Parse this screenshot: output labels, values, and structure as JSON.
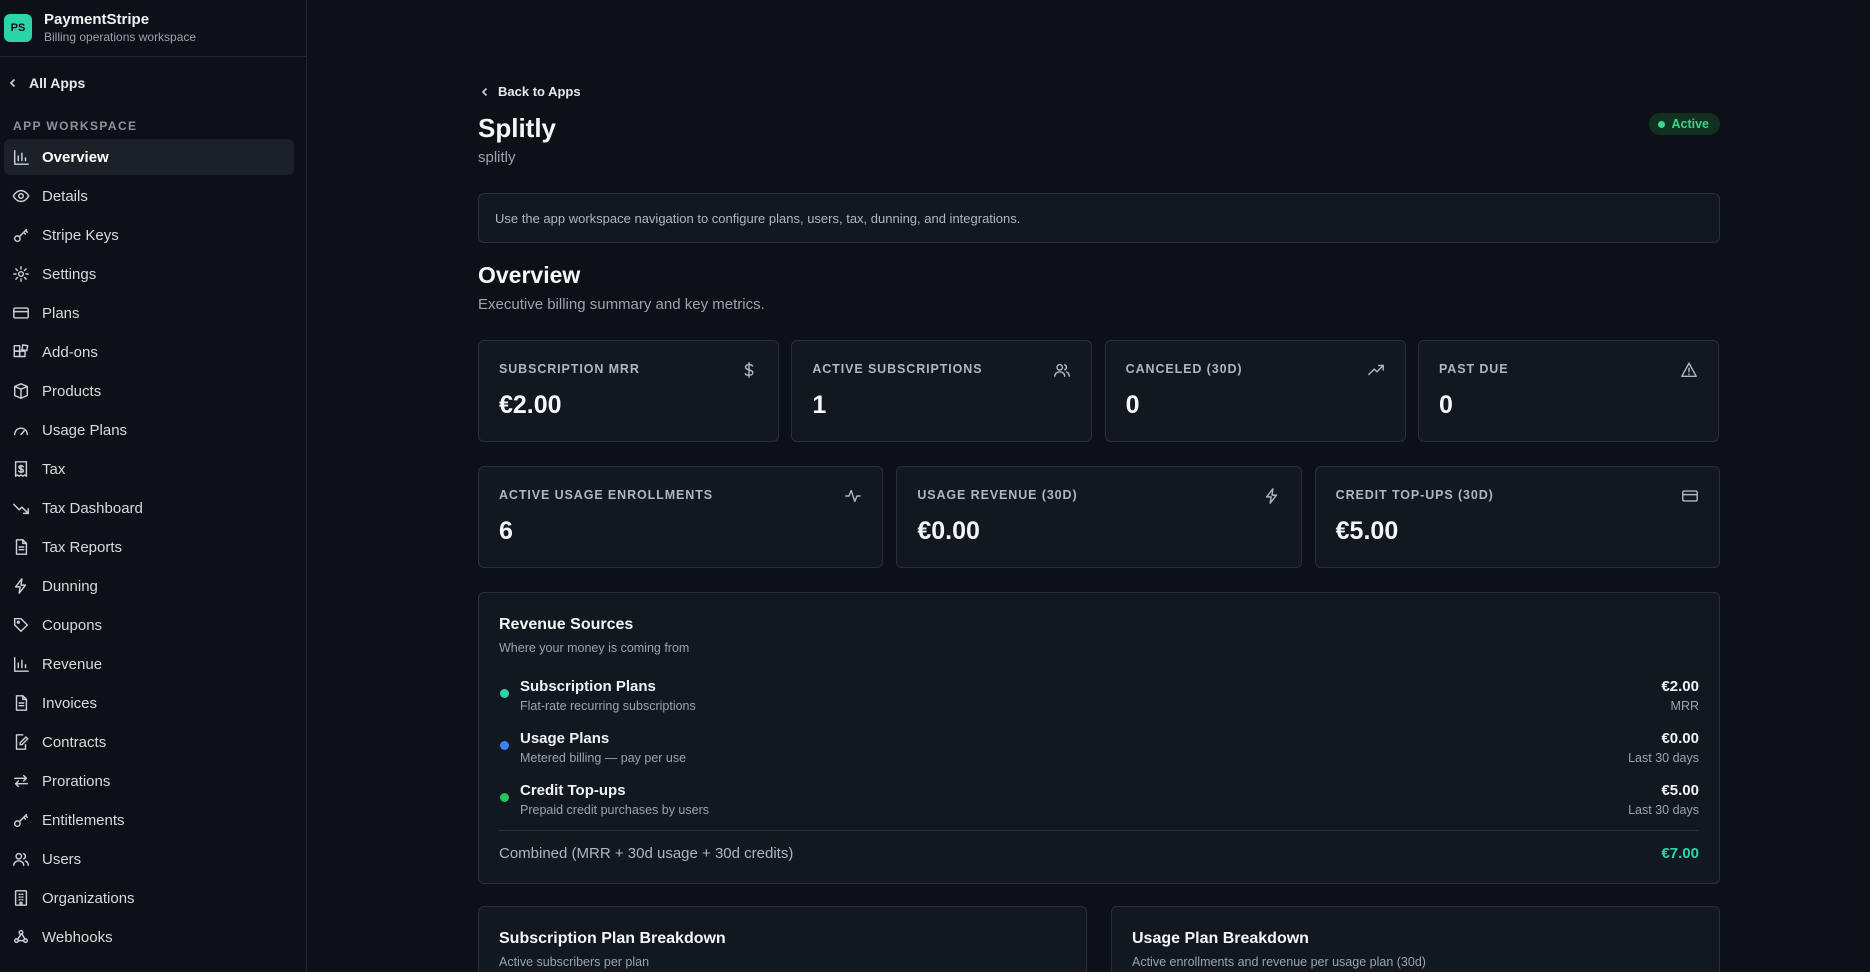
{
  "brand": {
    "logo": "PS",
    "name": "PaymentStripe",
    "subtitle": "Billing operations workspace"
  },
  "sidebar": {
    "all_apps": "All Apps",
    "section_label": "APP WORKSPACE",
    "items": [
      {
        "label": "Overview",
        "icon": "bar-chart-icon",
        "active": true
      },
      {
        "label": "Details",
        "icon": "eye-icon"
      },
      {
        "label": "Stripe Keys",
        "icon": "key-icon"
      },
      {
        "label": "Settings",
        "icon": "gear-icon"
      },
      {
        "label": "Plans",
        "icon": "credit-card-icon"
      },
      {
        "label": "Add-ons",
        "icon": "blocks-icon"
      },
      {
        "label": "Products",
        "icon": "package-icon"
      },
      {
        "label": "Usage Plans",
        "icon": "gauge-icon"
      },
      {
        "label": "Tax",
        "icon": "receipt-icon"
      },
      {
        "label": "Tax Dashboard",
        "icon": "trending-down-icon"
      },
      {
        "label": "Tax Reports",
        "icon": "file-text-icon"
      },
      {
        "label": "Dunning",
        "icon": "zap-icon"
      },
      {
        "label": "Coupons",
        "icon": "tag-icon"
      },
      {
        "label": "Revenue",
        "icon": "bar-chart-icon"
      },
      {
        "label": "Invoices",
        "icon": "file-text-icon"
      },
      {
        "label": "Contracts",
        "icon": "file-pen-icon"
      },
      {
        "label": "Prorations",
        "icon": "arrows-swap-icon"
      },
      {
        "label": "Entitlements",
        "icon": "key-icon"
      },
      {
        "label": "Users",
        "icon": "users-icon"
      },
      {
        "label": "Organizations",
        "icon": "building-icon"
      },
      {
        "label": "Webhooks",
        "icon": "webhook-icon"
      }
    ]
  },
  "header": {
    "back_label": "Back to Apps",
    "app_name": "Splitly",
    "app_slug": "splitly",
    "status": "Active"
  },
  "notice": "Use the app workspace navigation to configure plans, users, tax, dunning, and integrations.",
  "overview": {
    "title": "Overview",
    "subtitle": "Executive billing summary and key metrics."
  },
  "metrics_row1": [
    {
      "label": "SUBSCRIPTION MRR",
      "value": "€2.00",
      "icon": "dollar-icon"
    },
    {
      "label": "ACTIVE SUBSCRIPTIONS",
      "value": "1",
      "icon": "users-icon"
    },
    {
      "label": "CANCELED (30D)",
      "value": "0",
      "icon": "trending-up-icon"
    },
    {
      "label": "PAST DUE",
      "value": "0",
      "icon": "warning-icon"
    }
  ],
  "metrics_row2": [
    {
      "label": "ACTIVE USAGE ENROLLMENTS",
      "value": "6",
      "icon": "activity-icon"
    },
    {
      "label": "USAGE REVENUE (30D)",
      "value": "€0.00",
      "icon": "zap-icon"
    },
    {
      "label": "CREDIT TOP-UPS (30D)",
      "value": "€5.00",
      "icon": "credit-card-icon"
    }
  ],
  "revenue_sources": {
    "title": "Revenue Sources",
    "subtitle": "Where your money is coming from",
    "items": [
      {
        "name": "Subscription Plans",
        "desc": "Flat-rate recurring subscriptions",
        "value": "€2.00",
        "period": "MRR",
        "color": "#2dd4a8"
      },
      {
        "name": "Usage Plans",
        "desc": "Metered billing — pay per use",
        "value": "€0.00",
        "period": "Last 30 days",
        "color": "#3b82f6"
      },
      {
        "name": "Credit Top-ups",
        "desc": "Prepaid credit purchases by users",
        "value": "€5.00",
        "period": "Last 30 days",
        "color": "#22c55e"
      }
    ],
    "combined_label": "Combined (MRR + 30d usage + 30d credits)",
    "combined_value": "€7.00"
  },
  "breakdowns": [
    {
      "title": "Subscription Plan Breakdown",
      "subtitle": "Active subscribers per plan"
    },
    {
      "title": "Usage Plan Breakdown",
      "subtitle": "Active enrollments and revenue per usage plan (30d)"
    }
  ]
}
